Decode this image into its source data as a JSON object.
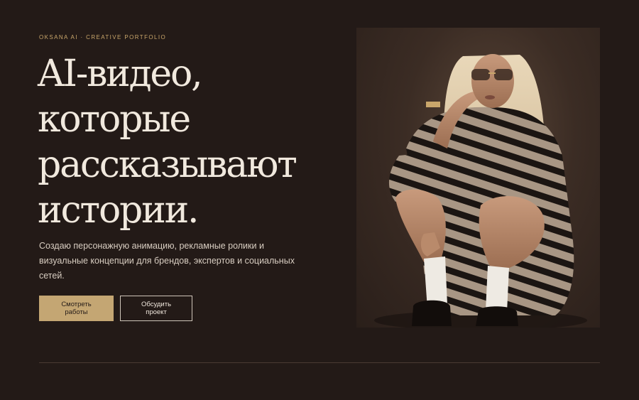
{
  "hero": {
    "eyebrow": "OKSANA AI · CREATIVE PORTFOLIO",
    "headline_lines": [
      "AI-видео,",
      "которые",
      "рассказывают",
      "истории."
    ],
    "description": "Создаю персонажную анимацию, рекламные ролики и визуальные концепции для брендов, экспертов и социальных сетей.",
    "primary_button": "Смотреть работы",
    "secondary_button": "Обсудить проект"
  },
  "colors": {
    "background": "#231a17",
    "accent": "#c4a673",
    "text": "#f1e9de"
  }
}
